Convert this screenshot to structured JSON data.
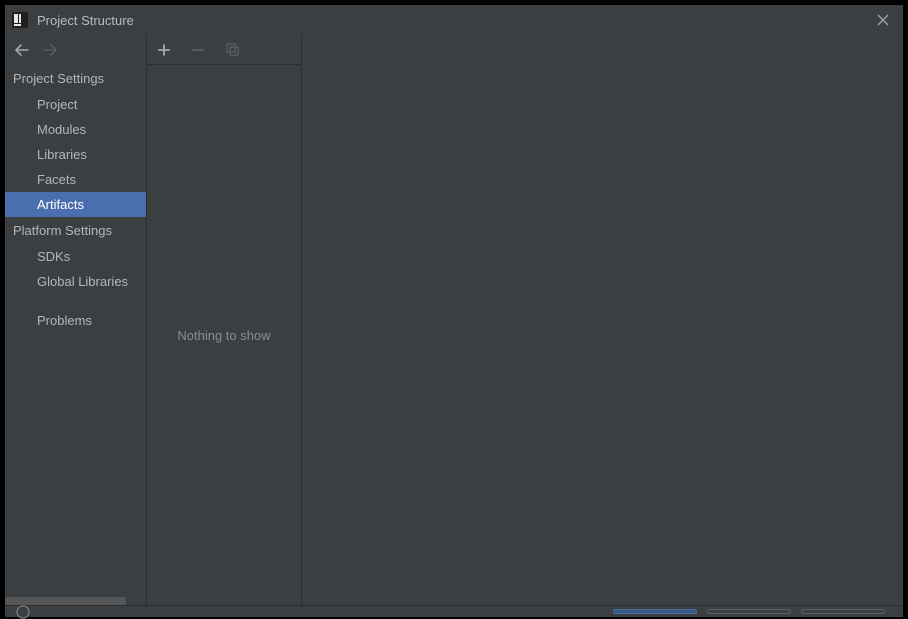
{
  "window": {
    "title": "Project Structure"
  },
  "nav": {
    "back_enabled": true,
    "forward_enabled": false,
    "sections": {
      "project_settings": {
        "label": "Project Settings",
        "items": [
          {
            "key": "project",
            "label": "Project"
          },
          {
            "key": "modules",
            "label": "Modules"
          },
          {
            "key": "libraries",
            "label": "Libraries"
          },
          {
            "key": "facets",
            "label": "Facets"
          },
          {
            "key": "artifacts",
            "label": "Artifacts",
            "selected": true
          }
        ]
      },
      "platform_settings": {
        "label": "Platform Settings",
        "items": [
          {
            "key": "sdks",
            "label": "SDKs"
          },
          {
            "key": "global_libraries",
            "label": "Global Libraries"
          }
        ]
      },
      "problems": {
        "label": "Problems"
      }
    }
  },
  "toolbar": {
    "add_enabled": true,
    "remove_enabled": false,
    "copy_enabled": false
  },
  "middle": {
    "empty_text": "Nothing to show"
  }
}
